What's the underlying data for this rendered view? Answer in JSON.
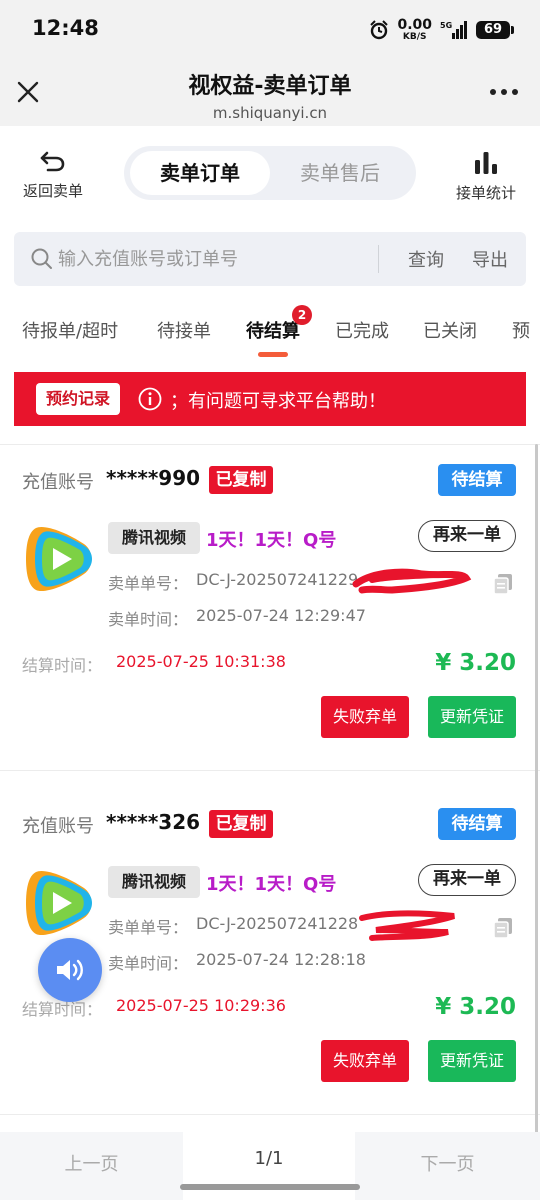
{
  "status_bar": {
    "time": "12:48",
    "net_speed_value": "0.00",
    "net_speed_unit": "KB/S",
    "network": "5G",
    "battery": "69"
  },
  "title_bar": {
    "title": "视权益-卖单订单",
    "subtitle": "m.shiquanyi.cn"
  },
  "top_actions": {
    "back_label": "返回卖单",
    "seg_active": "卖单订单",
    "seg_inactive": "卖单售后",
    "stats_label": "接单统计"
  },
  "search": {
    "placeholder": "输入充值账号或订单号",
    "search_label": "查询",
    "export_label": "导出"
  },
  "tabs": [
    {
      "label": "待报单/超时"
    },
    {
      "label": "待接单"
    },
    {
      "label": "待结算",
      "badge": "2"
    },
    {
      "label": "已完成"
    },
    {
      "label": "已关闭"
    },
    {
      "label": "预"
    }
  ],
  "notice": {
    "button": "预约记录",
    "text": "；有问题可寻求平台帮助！"
  },
  "labels": {
    "account": "充值账号",
    "copied": "已复制",
    "reorder": "再来一单",
    "order_no": "卖单单号：",
    "order_time": "卖单时间：",
    "settle_time": "结算时间：",
    "fail": "失败弃单",
    "update": "更新凭证"
  },
  "orders": [
    {
      "account": "*****990",
      "status": "待结算",
      "platform": "腾讯视频",
      "product": "1天！1天！Q号",
      "order_no": "DC-J-202507241229",
      "order_time": "2025-07-24 12:29:47",
      "settle_time": "2025-07-25 10:31:38",
      "price": "¥ 3.20"
    },
    {
      "account": "*****326",
      "status": "待结算",
      "platform": "腾讯视频",
      "product": "1天！1天！Q号",
      "order_no": "DC-J-202507241228",
      "order_time": "2025-07-24 12:28:18",
      "settle_time": "2025-07-25 10:29:36",
      "price": "¥ 3.20"
    }
  ],
  "pager": {
    "prev": "上一页",
    "current": "1/1",
    "next": "下一页"
  },
  "colors": {
    "accent_red": "#e8142c",
    "status_blue": "#2a8ff0",
    "price_green": "#1db954",
    "product_purple": "#b81cc8"
  }
}
